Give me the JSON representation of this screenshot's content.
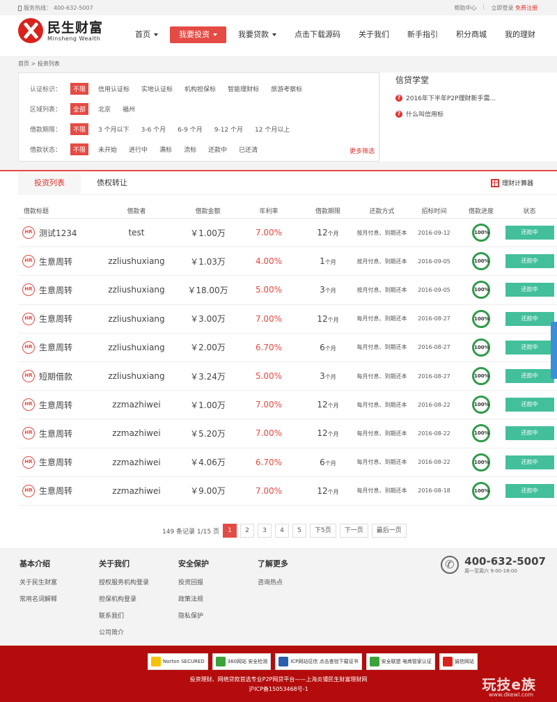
{
  "topbar": {
    "hotline_label": "服务热线：",
    "hotline_number": "400-632-5007",
    "help": "帮助中心",
    "login": "立即登录",
    "register": "免费注册"
  },
  "logo": {
    "cn": "民生财富",
    "en": "Minsheng Wealth"
  },
  "nav": [
    {
      "label": "首页",
      "caret": true
    },
    {
      "label": "我要投资",
      "caret": true,
      "active": true
    },
    {
      "label": "我要贷款",
      "caret": true
    },
    {
      "label": "点击下载源码"
    },
    {
      "label": "关于我们"
    },
    {
      "label": "新手指引"
    },
    {
      "label": "积分商城"
    },
    {
      "label": "我的理财"
    }
  ],
  "breadcrumb": "首页 > 投资列表",
  "filters": {
    "certification": {
      "label": "认证标识：",
      "options": [
        "不限",
        "信用认证标",
        "实地认证标",
        "机构担保标",
        "智能理财标",
        "旅游考察标"
      ]
    },
    "region": {
      "label": "区域列表：",
      "options": [
        "全部",
        "北京",
        "福州"
      ]
    },
    "term": {
      "label": "借款期限：",
      "options": [
        "不限",
        "3 个月以下",
        "3-6 个月",
        "6-9 个月",
        "9-12 个月",
        "12 个月以上"
      ]
    },
    "status": {
      "label": "借款状态：",
      "options": [
        "不限",
        "未开始",
        "进行中",
        "满标",
        "流标",
        "还款中",
        "已还清"
      ]
    },
    "more": "更多筛选"
  },
  "school": {
    "title": "信贷学堂",
    "items": [
      "2016年下半年P2P理财新手需...",
      "什么叫信用标"
    ]
  },
  "tabs": [
    "投资列表",
    "债权转让"
  ],
  "calculator": "理财计算器",
  "table": {
    "headers": [
      "借款标题",
      "借款者",
      "借款金额",
      "年利率",
      "借款期限",
      "还款方式",
      "招标时间",
      "借款进度",
      "状态"
    ],
    "badge": "HR",
    "rows": [
      {
        "title": "测试1234",
        "borrower": "test",
        "amount": "￥1.00万",
        "rate": "7.00%",
        "term": "12",
        "unit": "个月",
        "repay": "按月付息、到期还本",
        "date": "2016-09-12",
        "progress": "100%",
        "status": "还款中"
      },
      {
        "title": "生意周转",
        "borrower": "zzliushuxiang",
        "amount": "￥1.03万",
        "rate": "4.00%",
        "term": "1",
        "unit": "个月",
        "repay": "按月付息、到期还本",
        "date": "2016-09-05",
        "progress": "100%",
        "status": "还款中"
      },
      {
        "title": "生意周转",
        "borrower": "zzliushuxiang",
        "amount": "￥18.00万",
        "rate": "5.00%",
        "term": "3",
        "unit": "个月",
        "repay": "按月付息、到期还本",
        "date": "2016-09-05",
        "progress": "100%",
        "status": "还款中"
      },
      {
        "title": "生意周转",
        "borrower": "zzliushuxiang",
        "amount": "￥3.00万",
        "rate": "7.00%",
        "term": "12",
        "unit": "个月",
        "repay": "每月付息、到期还本",
        "date": "2016-08-27",
        "progress": "100%",
        "status": "还款中"
      },
      {
        "title": "生意周转",
        "borrower": "zzliushuxiang",
        "amount": "￥2.00万",
        "rate": "6.70%",
        "term": "6",
        "unit": "个月",
        "repay": "每月付息、到期还本",
        "date": "2016-08-27",
        "progress": "100%",
        "status": "还款中"
      },
      {
        "title": "短期借款",
        "borrower": "zzliushuxiang",
        "amount": "￥3.24万",
        "rate": "5.00%",
        "term": "3",
        "unit": "个月",
        "repay": "每月付息、到期还本",
        "date": "2016-08-27",
        "progress": "100%",
        "status": "还款中"
      },
      {
        "title": "生意周转",
        "borrower": "zzmazhiwei",
        "amount": "￥1.00万",
        "rate": "7.00%",
        "term": "12",
        "unit": "个月",
        "repay": "每月付息、到期还本",
        "date": "2016-08-22",
        "progress": "100%",
        "status": "还款中"
      },
      {
        "title": "生意周转",
        "borrower": "zzmazhiwei",
        "amount": "￥5.20万",
        "rate": "7.00%",
        "term": "12",
        "unit": "个月",
        "repay": "每月付息、到期还本",
        "date": "2016-08-22",
        "progress": "100%",
        "status": "还款中"
      },
      {
        "title": "生意周转",
        "borrower": "zzmazhiwei",
        "amount": "￥4.06万",
        "rate": "6.70%",
        "term": "6",
        "unit": "个月",
        "repay": "每月付息、到期还本",
        "date": "2016-08-22",
        "progress": "100%",
        "status": "还款中"
      },
      {
        "title": "生意周转",
        "borrower": "zzmazhiwei",
        "amount": "￥9.00万",
        "rate": "7.00%",
        "term": "12",
        "unit": "个月",
        "repay": "每月付息、到期还本",
        "date": "2016-08-18",
        "progress": "100%",
        "status": "还款中"
      }
    ]
  },
  "pager": {
    "summary": "149 条记录 1/15 页",
    "pages": [
      "1",
      "2",
      "3",
      "4",
      "5"
    ],
    "next5": "下5页",
    "next": "下一页",
    "last": "最后一页"
  },
  "footer": {
    "cols": [
      {
        "title": "基本介绍",
        "links": [
          "关于民生财富",
          "常用名词解释"
        ]
      },
      {
        "title": "关于我们",
        "links": [
          "授权服务机构登录",
          "担保机构登录",
          "联系我们",
          "公司简介"
        ]
      },
      {
        "title": "安全保护",
        "links": [
          "投资回报",
          "政策法规",
          "隐私保护"
        ]
      },
      {
        "title": "了解更多",
        "links": [
          "咨询热点"
        ]
      }
    ],
    "phone": "400-632-5007",
    "hours": "周一至周六 9:00-18:00"
  },
  "bottom": {
    "badges": [
      "Norton SECURED",
      "360网站 安全检测",
      "ICP网站征信 点击查验下载证书",
      "安全联盟 电商管家认证",
      "诚信网站"
    ],
    "line1": "投资理财、网络贷款首选专业P2P网贷平台——上海炎锺民生财富理财网",
    "line2": "沪ICP备15053468号-1",
    "watermark": "玩技e族",
    "watermark_url": "www.dkewl.com"
  },
  "colors": {
    "brand_red": "#e44b44",
    "status_green": "#43bf9b",
    "progress_green": "#2f9a4a",
    "footer_red": "#b40c0c"
  }
}
